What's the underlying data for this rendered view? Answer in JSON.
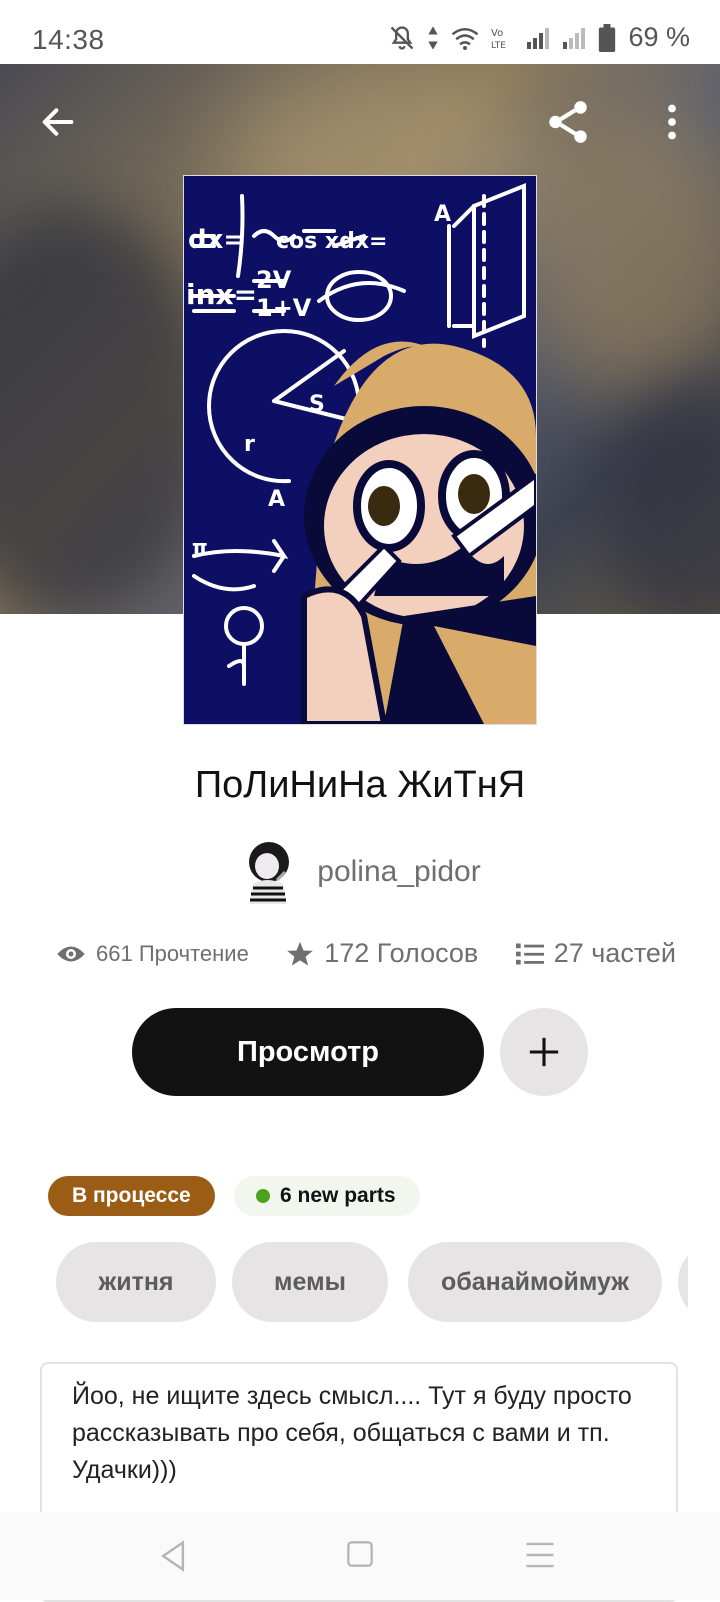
{
  "status_bar": {
    "time": "14:38",
    "network_label": "Vo LTE",
    "battery": "69 %",
    "icons": [
      "mute-icon",
      "data-arrows-icon",
      "wifi-icon",
      "volte-icon",
      "signal-icon",
      "signal-icon",
      "battery-icon"
    ]
  },
  "header": {
    "back_icon": "arrow-left-icon",
    "share_icon": "share-icon",
    "more_icon": "more-vertical-icon"
  },
  "story": {
    "title": "ПоЛиНиНа ЖиТнЯ",
    "author": "polina_pidor",
    "stats": {
      "reads": "661 Прочтение",
      "votes": "172 Голосов",
      "parts": "27 частей"
    },
    "read_button": "Просмотр",
    "status_badge": "В процессе",
    "new_parts_badge": "6 new parts",
    "tags": [
      "житня",
      "мемы",
      "обанаймоймуж"
    ],
    "description": "Йоо, не ищите здесь смысл.... Тут я буду просто рассказывать про себя, общаться с вами и тп. Удачки)))"
  },
  "colors": {
    "primary_button": "#121212",
    "status_badge": "#9b5d15",
    "new_dot": "#4ea31d",
    "cover_bg": "#0c0f63",
    "tag_bg": "#e6e4e5"
  }
}
